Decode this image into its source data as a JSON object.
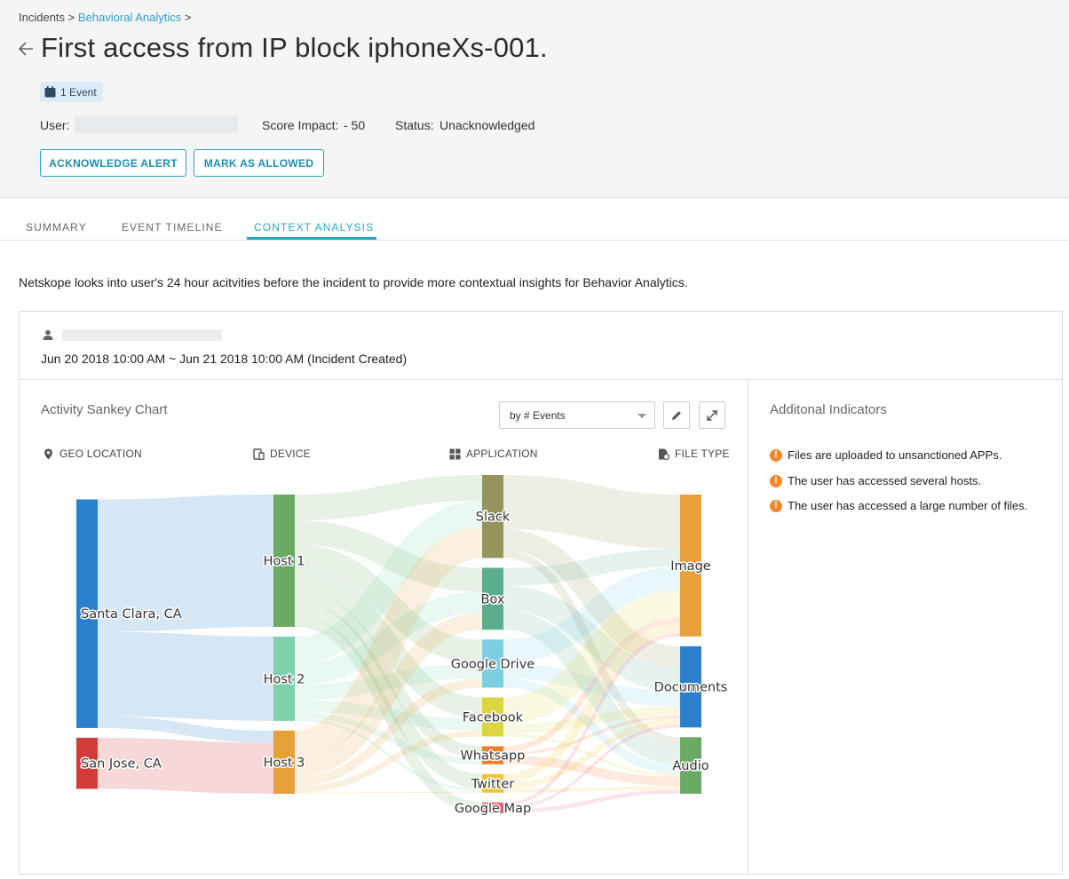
{
  "breadcrumb": {
    "root": "Incidents",
    "sep": ">",
    "current": "Behavioral Analytics"
  },
  "title": "First access from IP block iphoneXs-001.",
  "event_badge": "1 Event",
  "meta": {
    "user_label": "User:",
    "score_label": "Score Impact:",
    "score_value": "- 50",
    "status_label": "Status:",
    "status_value": "Unacknowledged"
  },
  "buttons": {
    "acknowledge": "ACKNOWLEDGE ALERT",
    "allow": "MARK AS ALLOWED"
  },
  "tabs": [
    {
      "label": "SUMMARY",
      "active": false
    },
    {
      "label": "EVENT TIMELINE",
      "active": false
    },
    {
      "label": "CONTEXT ANALYSIS",
      "active": true
    }
  ],
  "intro": "Netskope looks into user's 24 hour acitvities before the incident to provide more contextual insights for Behavior Analytics.",
  "time_range": "Jun 20 2018 10:00 AM ~ Jun 21 2018 10:00 AM (Incident Created)",
  "chart_panel": {
    "title": "Activity Sankey Chart",
    "metric_select": "by # Events",
    "columns": [
      "GEO LOCATION",
      "DEVICE",
      "APPLICATION",
      "FILE TYPE"
    ]
  },
  "chart_data": {
    "type": "sankey",
    "title": "Activity Sankey Chart",
    "stages": [
      "GEO LOCATION",
      "DEVICE",
      "APPLICATION",
      "FILE TYPE"
    ],
    "nodes": [
      {
        "id": "Santa Clara, CA",
        "stage": 0,
        "color": "#2b80cc"
      },
      {
        "id": "San Jose, CA",
        "stage": 0,
        "color": "#d33b3b"
      },
      {
        "id": "Host 1",
        "stage": 1,
        "color": "#6aaa64"
      },
      {
        "id": "Host 2",
        "stage": 1,
        "color": "#7fd1ae"
      },
      {
        "id": "Host 3",
        "stage": 1,
        "color": "#e8a03a"
      },
      {
        "id": "Slack",
        "stage": 2,
        "color": "#95955b"
      },
      {
        "id": "Box",
        "stage": 2,
        "color": "#5bae8c"
      },
      {
        "id": "Google Drive",
        "stage": 2,
        "color": "#7ccfe0"
      },
      {
        "id": "Facebook",
        "stage": 2,
        "color": "#dcd541"
      },
      {
        "id": "Whatsapp",
        "stage": 2,
        "color": "#f07f2a"
      },
      {
        "id": "Twitter",
        "stage": 2,
        "color": "#f6c32e"
      },
      {
        "id": "Google Map",
        "stage": 2,
        "color": "#ee5f6e"
      },
      {
        "id": "Image",
        "stage": 3,
        "color": "#e8a03a"
      },
      {
        "id": "Documents",
        "stage": 3,
        "color": "#2b80cc"
      },
      {
        "id": "Audio",
        "stage": 3,
        "color": "#6aaa64"
      }
    ],
    "links": [
      {
        "source": "Santa Clara, CA",
        "target": "Host 1",
        "value": 22
      },
      {
        "source": "Santa Clara, CA",
        "target": "Host 2",
        "value": 14
      },
      {
        "source": "Santa Clara, CA",
        "target": "Host 3",
        "value": 2
      },
      {
        "source": "San Jose, CA",
        "target": "Host 3",
        "value": 8.5
      },
      {
        "source": "Host 1",
        "target": "Slack",
        "value": 4.3
      },
      {
        "source": "Host 1",
        "target": "Box",
        "value": 4
      },
      {
        "source": "Host 1",
        "target": "Google Drive",
        "value": 4
      },
      {
        "source": "Host 1",
        "target": "Facebook",
        "value": 3.5
      },
      {
        "source": "Host 1",
        "target": "Whatsapp",
        "value": 2
      },
      {
        "source": "Host 1",
        "target": "Twitter",
        "value": 2.4
      },
      {
        "source": "Host 1",
        "target": "Google Map",
        "value": 1.8
      },
      {
        "source": "Host 2",
        "target": "Slack",
        "value": 4.5
      },
      {
        "source": "Host 2",
        "target": "Box",
        "value": 3.5
      },
      {
        "source": "Host 2",
        "target": "Google Drive",
        "value": 2.5
      },
      {
        "source": "Host 2",
        "target": "Facebook",
        "value": 2
      },
      {
        "source": "Host 2",
        "target": "Whatsapp",
        "value": 1
      },
      {
        "source": "Host 2",
        "target": "Twitter",
        "value": 0.5
      },
      {
        "source": "Host 3",
        "target": "Slack",
        "value": 5
      },
      {
        "source": "Host 3",
        "target": "Box",
        "value": 2.8
      },
      {
        "source": "Host 3",
        "target": "Google Drive",
        "value": 1.5
      },
      {
        "source": "Host 3",
        "target": "Facebook",
        "value": 1
      },
      {
        "source": "Host 3",
        "target": "Twitter",
        "value": 0.2
      },
      {
        "source": "Slack",
        "target": "Image",
        "value": 9
      },
      {
        "source": "Slack",
        "target": "Documents",
        "value": 3.5
      },
      {
        "source": "Slack",
        "target": "Audio",
        "value": 1.3
      },
      {
        "source": "Box",
        "target": "Image",
        "value": 3
      },
      {
        "source": "Box",
        "target": "Documents",
        "value": 4
      },
      {
        "source": "Box",
        "target": "Audio",
        "value": 3.3
      },
      {
        "source": "Google Drive",
        "target": "Image",
        "value": 4
      },
      {
        "source": "Google Drive",
        "target": "Documents",
        "value": 2.5
      },
      {
        "source": "Google Drive",
        "target": "Audio",
        "value": 1.5
      },
      {
        "source": "Facebook",
        "target": "Image",
        "value": 4.5
      },
      {
        "source": "Facebook",
        "target": "Documents",
        "value": 1.5
      },
      {
        "source": "Facebook",
        "target": "Audio",
        "value": 0.5
      },
      {
        "source": "Whatsapp",
        "target": "Image",
        "value": 1
      },
      {
        "source": "Whatsapp",
        "target": "Documents",
        "value": 0.5
      },
      {
        "source": "Whatsapp",
        "target": "Audio",
        "value": 1.5
      },
      {
        "source": "Twitter",
        "target": "Image",
        "value": 1.5
      },
      {
        "source": "Twitter",
        "target": "Documents",
        "value": 1
      },
      {
        "source": "Twitter",
        "target": "Audio",
        "value": 0.6
      },
      {
        "source": "Google Map",
        "target": "Image",
        "value": 0.6
      },
      {
        "source": "Google Map",
        "target": "Documents",
        "value": 0.5
      },
      {
        "source": "Google Map",
        "target": "Audio",
        "value": 0.7
      }
    ]
  },
  "indicators_panel": {
    "title": "Additonal Indicators",
    "items": [
      "Files are uploaded to unsanctioned APPs.",
      "The user has accessed several hosts.",
      "The user has accessed a large number of files."
    ]
  },
  "colors": {
    "accent": "#26a3c9",
    "warning": "#f0892a"
  }
}
